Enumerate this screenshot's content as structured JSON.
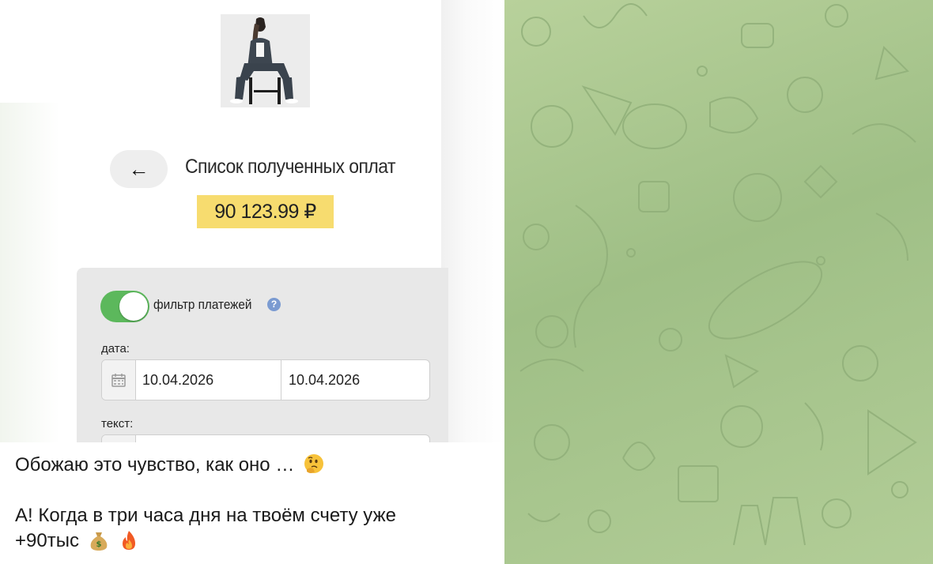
{
  "app_screenshot": {
    "title": "Список полученных оплат",
    "amount": "90 123.99 ₽",
    "back_label": "←",
    "filter": {
      "toggle_on": true,
      "label": "фильтр платежей",
      "help": "?"
    },
    "date_label": "дата:",
    "date_from": "10.04.2026",
    "date_to": "10.04.2026",
    "text_label": "текст:"
  },
  "caption": {
    "line1": "Обожаю это чувство, как оно …",
    "line1_emoji": "thinking-face-emoji",
    "line2": "А! Когда в три часа дня на твоём счету уже",
    "line3": "+90тыс",
    "line3_emojis": [
      "money-bag-emoji",
      "fire-emoji"
    ]
  },
  "colors": {
    "amount_highlight": "#f7dc6f",
    "toggle_on": "#5cb85c",
    "chat_background": "#a9c691",
    "help_icon": "#7b9bd1"
  }
}
